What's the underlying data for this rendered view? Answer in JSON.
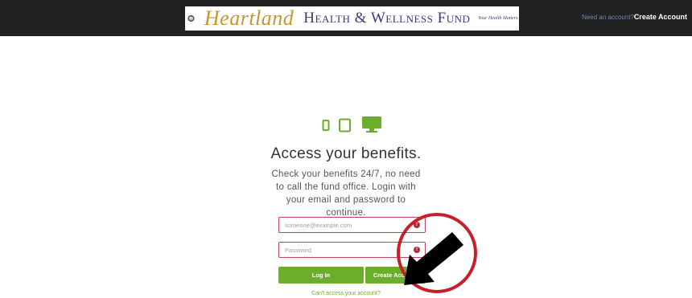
{
  "header": {
    "logo": {
      "script_text": "Heartland",
      "name_text": "Health & Wellness Fund",
      "tagline": "Your Health Matters."
    },
    "need_account": "Need an account?",
    "create_account": "Create Account"
  },
  "main": {
    "device_icons": [
      "phone-icon",
      "tablet-icon",
      "desktop-icon"
    ],
    "title": "Access your benefits.",
    "subtitle": "Check your benefits 24/7, no need to call the fund office. Login with your email and password to continue.",
    "email_placeholder": "someone@example.com",
    "password_placeholder": "Password",
    "error_glyph": "!",
    "login_button": "Log In",
    "create_button": "Create Account",
    "cant_access": "Can't access your account?"
  },
  "colors": {
    "topbar": "#222222",
    "accent_green": "#6cad2c",
    "error_red": "#b02a3c",
    "annotation_red": "#c8202a"
  }
}
